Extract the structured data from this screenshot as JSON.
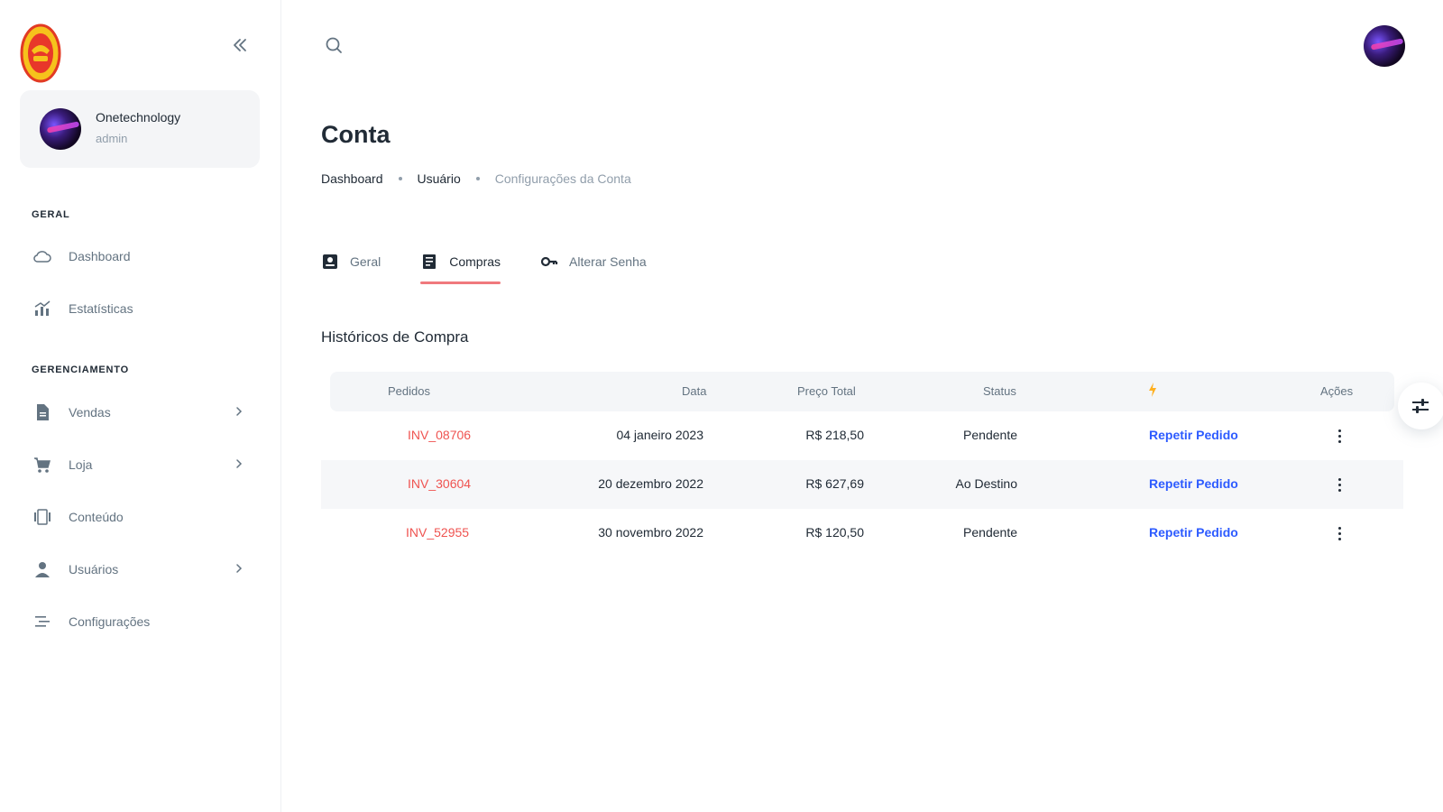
{
  "sidebar": {
    "account": {
      "name": "Onetechnology",
      "role": "admin"
    },
    "sections": [
      {
        "label": "GERAL",
        "items": [
          {
            "label": "Dashboard",
            "icon": "cloud-icon"
          },
          {
            "label": "Estatísticas",
            "icon": "analytics-icon"
          }
        ]
      },
      {
        "label": "GERENCIAMENTO",
        "items": [
          {
            "label": "Vendas",
            "icon": "invoice-icon",
            "has_children": true
          },
          {
            "label": "Loja",
            "icon": "cart-icon",
            "has_children": true
          },
          {
            "label": "Conteúdo",
            "icon": "content-icon",
            "has_children": false
          },
          {
            "label": "Usuários",
            "icon": "user-icon",
            "has_children": true
          },
          {
            "label": "Configurações",
            "icon": "settings-icon",
            "has_children": false
          }
        ]
      }
    ]
  },
  "page": {
    "title": "Conta",
    "breadcrumb": [
      "Dashboard",
      "Usuário",
      "Configurações da Conta"
    ]
  },
  "tabs": [
    {
      "label": "Geral",
      "icon": "id-card-icon",
      "active": false
    },
    {
      "label": "Compras",
      "icon": "receipt-icon",
      "active": true
    },
    {
      "label": "Alterar Senha",
      "icon": "key-icon",
      "active": false
    }
  ],
  "purchases": {
    "title": "Históricos de Compra",
    "columns": [
      "Pedidos",
      "Data",
      "Preço Total",
      "Status",
      "",
      "Ações"
    ],
    "header_icon": "lightning-icon",
    "rows": [
      {
        "order": "INV_08706",
        "date": "04 janeiro 2023",
        "total": "R$ 218,50",
        "status": "Pendente",
        "action": "Repetir Pedido"
      },
      {
        "order": "INV_30604",
        "date": "20 dezembro 2022",
        "total": "R$ 627,69",
        "status": "Ao Destino",
        "action": "Repetir Pedido"
      },
      {
        "order": "INV_52955",
        "date": "30 novembro 2022",
        "total": "R$ 120,50",
        "status": "Pendente",
        "action": "Repetir Pedido"
      }
    ]
  },
  "colors": {
    "accent_tab_underline": "#f0797d",
    "order_link": "#ef5350",
    "action_link": "#2d5bff",
    "header_bg": "#f4f6f8"
  }
}
